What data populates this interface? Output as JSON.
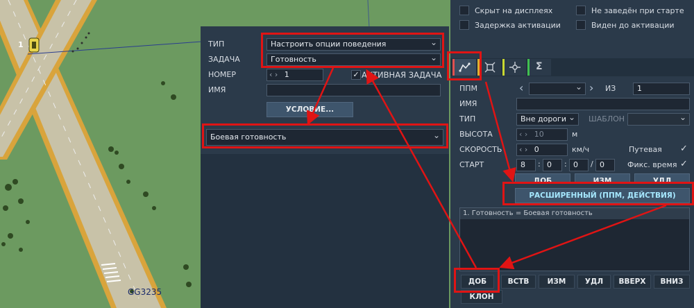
{
  "map": {
    "runway_label": "GG3235",
    "unit_number": "1"
  },
  "task_panel": {
    "type_label": "ТИП",
    "type_value": "Настроить опции поведения",
    "task_label": "ЗАДАЧА",
    "task_value": "Готовность",
    "number_label": "НОМЕР",
    "number_value": "1",
    "active_task_label": "АКТИВНАЯ ЗАДАЧА",
    "active_task_checked": "✓",
    "name_label": "ИМЯ",
    "name_value": "",
    "condition_button": "УСЛОВИЕ...",
    "readiness_value": "Боевая готовность"
  },
  "group_panel": {
    "hidden_on_display": "Скрыт на дисплеях",
    "not_started": "Не заведён при старте",
    "activation_delay": "Задержка активации",
    "visible_before_activation": "Виден до активации",
    "tab_icons": [
      "route-icon",
      "target-icon",
      "crosshair-icon",
      "sum-icon"
    ],
    "tab_sum_glyph": "Σ",
    "waypoint_label": "ППМ",
    "waypoint_of": "ИЗ",
    "waypoint_total": "1",
    "name_label": "ИМЯ",
    "type_label": "ТИП",
    "type_value": "Вне дороги",
    "template_label": "ШАБЛОН",
    "altitude_label": "ВЫСОТА",
    "altitude_value": "10",
    "altitude_unit": "м",
    "speed_label": "СКОРОСТЬ",
    "speed_value": "0",
    "speed_unit": "км/ч",
    "route_label": "Путевая",
    "start_label": "СТАРТ",
    "start_d": "8",
    "start_h": "0",
    "start_m": "0",
    "start_s": "0",
    "fixed_time_label": "Фикс. время",
    "add_button": "ДОБ",
    "edit_button": "ИЗМ",
    "delete_button": "УДЛ",
    "advanced_button": "РАСШИРЕННЫЙ (ППМ, ДЕЙСТВИЯ)",
    "action_list": [
      "1. Готовность = Боевая готовность"
    ],
    "bottom_buttons": [
      "ДОБ",
      "ВСТВ",
      "ИЗМ",
      "УДЛ",
      "ВВЕРХ",
      "ВНИЗ"
    ],
    "clone_button": "КЛОН"
  },
  "colors": {
    "panel_bg": "#2b3a4a",
    "highlight": "#e01414",
    "map_green": "#6c9a60",
    "runway": "#c8c2a8",
    "runway_edge": "#d9a43c"
  }
}
